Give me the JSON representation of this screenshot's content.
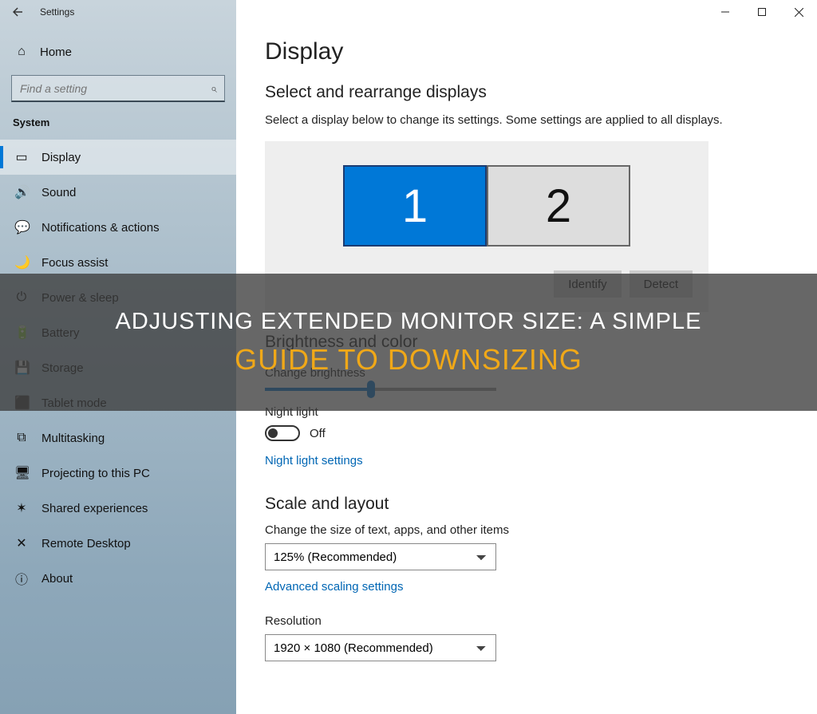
{
  "window": {
    "title": "Settings",
    "home": "Home",
    "search_placeholder": "Find a setting",
    "section": "System"
  },
  "nav": [
    {
      "label": "Display",
      "icon": "▭",
      "name": "display",
      "active": true
    },
    {
      "label": "Sound",
      "icon": "🔊",
      "name": "sound"
    },
    {
      "label": "Notifications & actions",
      "icon": "💬",
      "name": "notifications"
    },
    {
      "label": "Focus assist",
      "icon": "🌙",
      "name": "focus-assist"
    },
    {
      "label": "Power & sleep",
      "icon": "⏻",
      "name": "power-sleep"
    },
    {
      "label": "Battery",
      "icon": "🔋",
      "name": "battery"
    },
    {
      "label": "Storage",
      "icon": "💾",
      "name": "storage"
    },
    {
      "label": "Tablet mode",
      "icon": "⬛",
      "name": "tablet-mode"
    },
    {
      "label": "Multitasking",
      "icon": "⧉",
      "name": "multitasking"
    },
    {
      "label": "Projecting to this PC",
      "icon": "🖥",
      "name": "projecting"
    },
    {
      "label": "Shared experiences",
      "icon": "✶",
      "name": "shared-experiences"
    },
    {
      "label": "Remote Desktop",
      "icon": "✕",
      "name": "remote-desktop"
    },
    {
      "label": "About",
      "icon": "ⓘ",
      "name": "about"
    }
  ],
  "main": {
    "title": "Display",
    "rearrange_h": "Select and rearrange displays",
    "rearrange_text": "Select a display below to change its settings. Some settings are applied to all displays.",
    "monitor1": "1",
    "monitor2": "2",
    "identify_btn": "Identify",
    "detect_btn": "Detect",
    "brightness_h": "Brightness and color",
    "brightness_label": "Change brightness",
    "night_light_label": "Night light",
    "night_light_state": "Off",
    "night_light_link": "Night light settings",
    "scale_h": "Scale and layout",
    "scale_label": "Change the size of text, apps, and other items",
    "scale_value": "125% (Recommended)",
    "adv_scale_link": "Advanced scaling settings",
    "resolution_label": "Resolution",
    "resolution_value": "1920 × 1080 (Recommended)"
  },
  "overlay": {
    "line1": "ADJUSTING EXTENDED MONITOR SIZE: A SIMPLE",
    "line2": "GUIDE TO DOWNSIZING"
  }
}
